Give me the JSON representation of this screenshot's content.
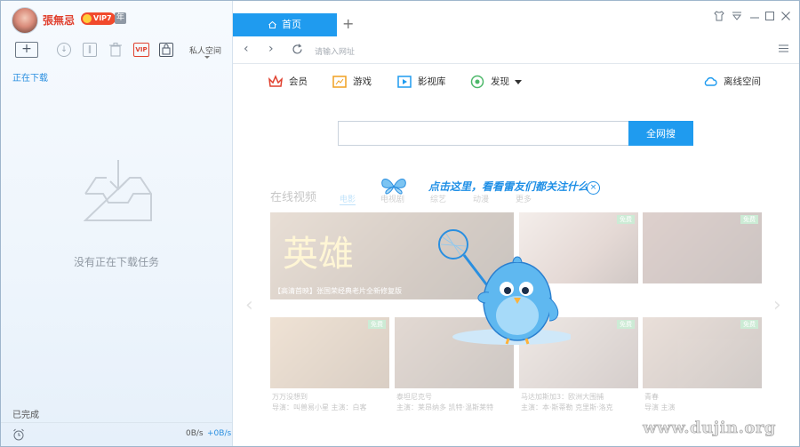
{
  "user": {
    "name": "張無忌",
    "vip_level": "VIP7",
    "year_badge": "年"
  },
  "left_toolbar": {
    "new_task": "+",
    "private_space": "私人空间"
  },
  "left": {
    "downloading_label": "正在下载",
    "empty_text": "没有正在下载任务",
    "completed_label": "已完成",
    "speed_down": "0B/s",
    "speed_up": "+0B/s"
  },
  "tabs": {
    "home_label": "首页",
    "add_label": "+"
  },
  "nav": {
    "address_placeholder": "请输入网址"
  },
  "categories": [
    {
      "label": "会员",
      "icon": "crown-icon"
    },
    {
      "label": "游戏",
      "icon": "game-icon"
    },
    {
      "label": "影视库",
      "icon": "film-icon"
    },
    {
      "label": "发现",
      "icon": "discover-icon"
    },
    {
      "label": "离线空间",
      "icon": "cloud-icon"
    }
  ],
  "search": {
    "button_label": "全网搜"
  },
  "content": {
    "section_title": "在线视频",
    "section_tabs": [
      "电影",
      "电视剧",
      "综艺",
      "动漫",
      "更多"
    ],
    "feature_caption": "【高清首映】张国荣经典老片全新修复版",
    "card_captions": [
      "万万没想到",
      "泰坦尼克号",
      "马达加斯加3：欧洲大围捕",
      "青春"
    ],
    "card_subs": [
      "导演：叫兽易小星 主演：白客",
      "主演：莱昂纳多 凯特·温斯莱特",
      "主演：本·斯蒂勒 克里斯·洛克",
      "导演 主演"
    ],
    "free_badge": "免费"
  },
  "promo": {
    "text": "点击这里，看看雷友们都关注什么",
    "close": "×"
  },
  "watermark": "www.dujin.org",
  "colors": {
    "accent": "#1f9bef",
    "vip_red": "#e0412f"
  }
}
